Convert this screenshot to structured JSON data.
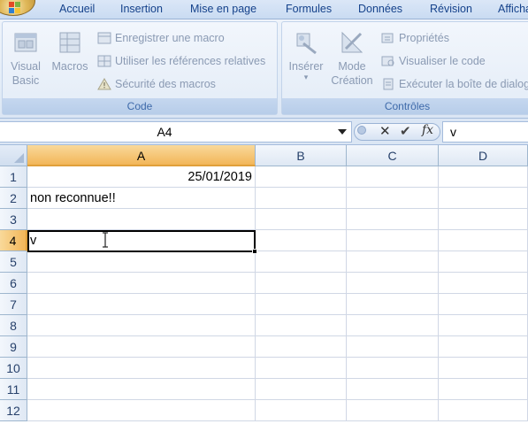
{
  "ribbon": {
    "tabs": [
      "Accueil",
      "Insertion",
      "Mise en page",
      "Formules",
      "Données",
      "Révision",
      "Affichage"
    ],
    "code_group": {
      "label": "Code",
      "visual_basic_line1": "Visual",
      "visual_basic_line2": "Basic",
      "macros": "Macros",
      "record_macro": "Enregistrer une macro",
      "relative_refs": "Utiliser les références relatives",
      "macro_security": "Sécurité des macros"
    },
    "controls_group": {
      "label": "Contrôles",
      "insert": "Insérer",
      "design_mode_line1": "Mode",
      "design_mode_line2": "Création",
      "properties": "Propriétés",
      "view_code": "Visualiser le code",
      "run_dialog": "Exécuter la boîte de dialogue"
    }
  },
  "formula_bar": {
    "name_box": "A4",
    "cancel_symbol": "✕",
    "enter_symbol": "✔",
    "fx_symbol": "fx",
    "content": "v"
  },
  "grid": {
    "columns": [
      "A",
      "B",
      "C",
      "D"
    ],
    "rows": [
      "1",
      "2",
      "3",
      "4",
      "5",
      "6",
      "7",
      "8",
      "9",
      "10",
      "11",
      "12"
    ],
    "active_cell": "A4",
    "cells": {
      "A1": "25/01/2019",
      "A2": "non reconnue!!",
      "A4": "v"
    }
  },
  "colors": {
    "tab_text": "#15428b",
    "disabled_text": "#8a9ab3",
    "active_header": "#f2b658",
    "gridline": "#d0d7e5"
  }
}
